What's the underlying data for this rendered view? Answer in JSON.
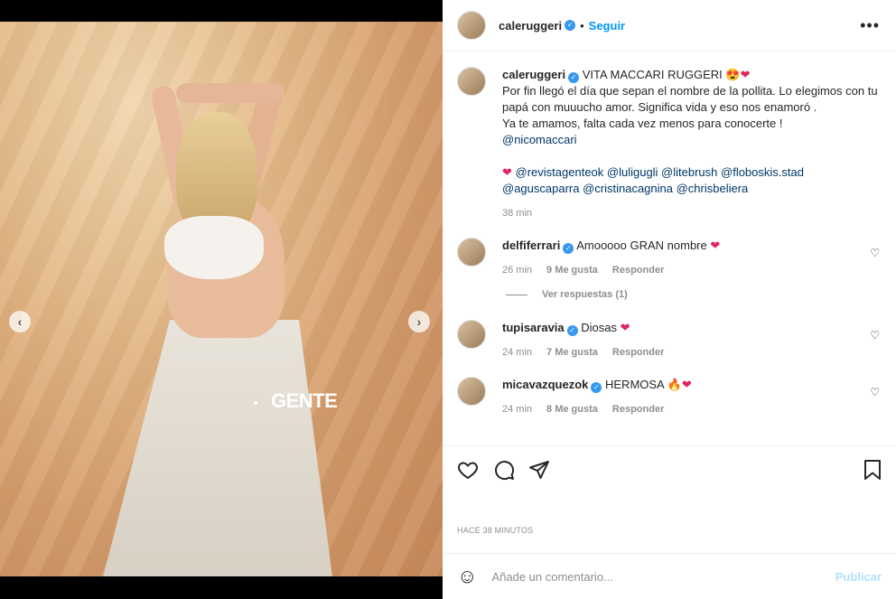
{
  "post": {
    "username": "caleruggeri",
    "follow_sep": "•",
    "follow_label": "Seguir",
    "more": "•••",
    "image_watermark": "GENTE",
    "carousel_prev": "‹",
    "carousel_next": "›"
  },
  "caption": {
    "username": "caleruggeri",
    "title": "VITA MACCARI RUGGERI",
    "title_emoji": "😍❤",
    "text": "Por fin llegó el día que sepan el nombre de la pollita. Lo elegimos con tu papá con muuucho amor. Significa vida y eso nos enamoró .\nYa te amamos, falta cada vez menos para conocerte !",
    "mention_main": "@nicomaccari",
    "credits_emoji": "❤",
    "credits": "@revistagenteok @luligugli @litebrush @floboskis.stad @aguscaparra @cristinacagnina @chrisbeliera",
    "time": "38 min"
  },
  "comments": [
    {
      "username": "delfiferrari",
      "text": "Amooooo GRAN nombre",
      "emoji": "❤",
      "time": "26 min",
      "likes": "9 Me gusta",
      "reply": "Responder"
    },
    {
      "username": "tupisaravia",
      "text": "Diosas",
      "emoji": "❤",
      "time": "24 min",
      "likes": "7 Me gusta",
      "reply": "Responder"
    },
    {
      "username": "micavazquezok",
      "text": "HERMOSA",
      "emoji": "🔥❤",
      "time": "24 min",
      "likes": "8 Me gusta",
      "reply": "Responder"
    }
  ],
  "view_replies": "Ver respuestas (1)",
  "timestamp": "HACE 38 MINUTOS",
  "add_comment": {
    "placeholder": "Añade un comentario...",
    "publish": "Publicar"
  }
}
